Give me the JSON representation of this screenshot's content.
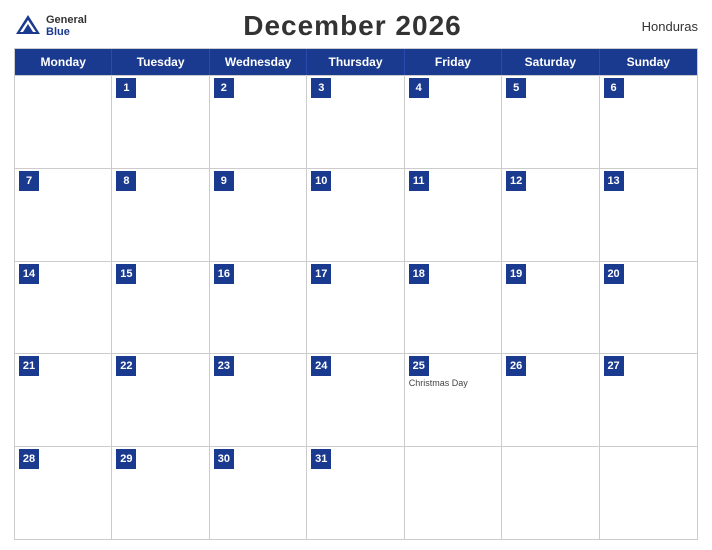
{
  "header": {
    "logo_general": "General",
    "logo_blue": "Blue",
    "title": "December 2026",
    "country": "Honduras"
  },
  "days_of_week": [
    "Monday",
    "Tuesday",
    "Wednesday",
    "Thursday",
    "Friday",
    "Saturday",
    "Sunday"
  ],
  "weeks": [
    [
      {
        "num": "",
        "empty": true
      },
      {
        "num": "1"
      },
      {
        "num": "2"
      },
      {
        "num": "3"
      },
      {
        "num": "4"
      },
      {
        "num": "5"
      },
      {
        "num": "6"
      }
    ],
    [
      {
        "num": "7"
      },
      {
        "num": "8"
      },
      {
        "num": "9"
      },
      {
        "num": "10"
      },
      {
        "num": "11"
      },
      {
        "num": "12"
      },
      {
        "num": "13"
      }
    ],
    [
      {
        "num": "14"
      },
      {
        "num": "15"
      },
      {
        "num": "16"
      },
      {
        "num": "17"
      },
      {
        "num": "18"
      },
      {
        "num": "19"
      },
      {
        "num": "20"
      }
    ],
    [
      {
        "num": "21"
      },
      {
        "num": "22"
      },
      {
        "num": "23"
      },
      {
        "num": "24"
      },
      {
        "num": "25",
        "event": "Christmas Day"
      },
      {
        "num": "26"
      },
      {
        "num": "27"
      }
    ],
    [
      {
        "num": "28"
      },
      {
        "num": "29"
      },
      {
        "num": "30"
      },
      {
        "num": "31"
      },
      {
        "num": "",
        "empty": true
      },
      {
        "num": "",
        "empty": true
      },
      {
        "num": "",
        "empty": true
      }
    ]
  ]
}
